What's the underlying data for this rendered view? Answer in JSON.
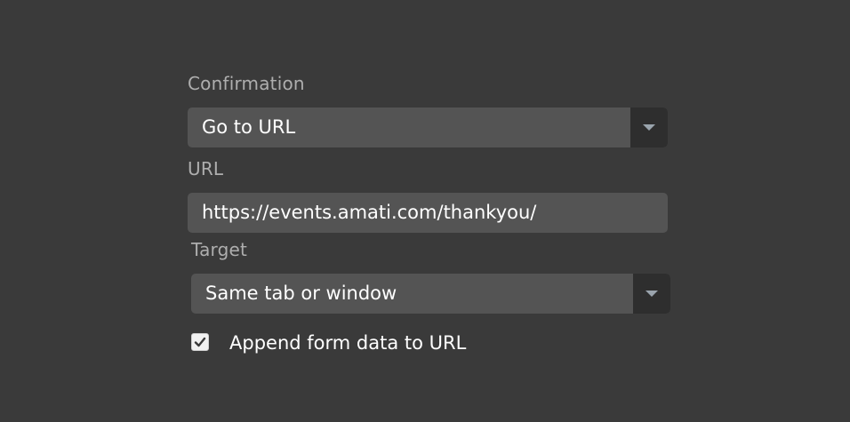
{
  "confirmation": {
    "label": "Confirmation",
    "selected": "Go to URL"
  },
  "url": {
    "label": "URL",
    "value": "https://events.amati.com/thankyou/"
  },
  "target": {
    "label": "Target",
    "selected": "Same tab or window"
  },
  "append": {
    "label": "Append form data to URL",
    "checked": true
  },
  "icons": {
    "dropdown": "chevron-down-icon",
    "checkbox": "checkmark-icon"
  },
  "colors": {
    "background": "#3a3a3a",
    "field": "#545454",
    "arrow_bg": "#2e2e2e",
    "label": "#aeaeae",
    "text": "#ffffff"
  }
}
